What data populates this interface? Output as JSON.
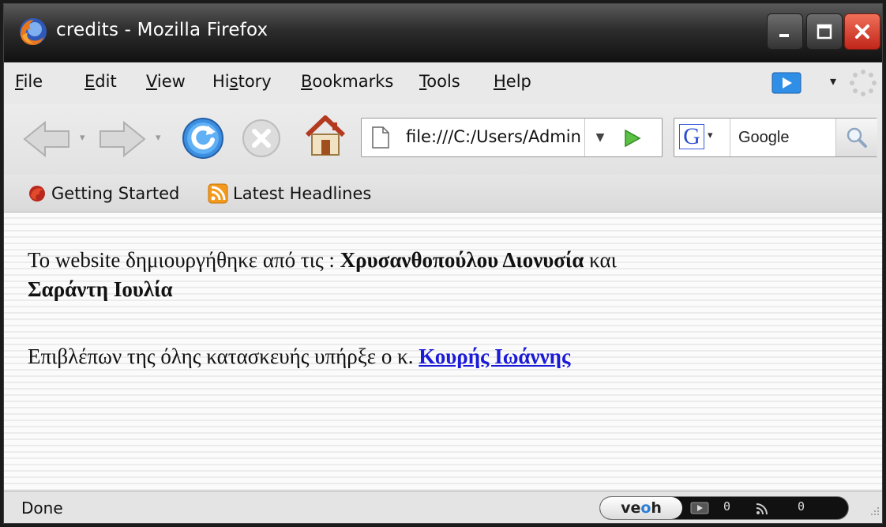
{
  "window": {
    "title": "credits - Mozilla Firefox"
  },
  "menu": {
    "items": [
      {
        "label": "File",
        "underline": "F",
        "rest": "ile"
      },
      {
        "label": "Edit",
        "underline": "E",
        "rest": "dit"
      },
      {
        "label": "View",
        "underline": "V",
        "rest": "iew"
      },
      {
        "label": "History",
        "pre": "Hi",
        "underline": "s",
        "rest": "tory"
      },
      {
        "label": "Bookmarks",
        "underline": "B",
        "rest": "ookmarks"
      },
      {
        "label": "Tools",
        "underline": "T",
        "rest": "ools"
      },
      {
        "label": "Help",
        "underline": "H",
        "rest": "elp"
      }
    ]
  },
  "navigation": {
    "url": "file:///C:/Users/Admin/credits.html",
    "search_placeholder": "Google",
    "search_engine_letter": "G"
  },
  "bookmarks": {
    "getting_started": "Getting Started",
    "latest_headlines": "Latest Headlines"
  },
  "content": {
    "p1_prefix": "Το website δημιουργήθηκε από τις : ",
    "p1_name1": "Χρυσανθοπούλου Διονυσία",
    "p1_and": " και ",
    "p1_name2": "Σαράντη Ιουλία",
    "p2_prefix": "Επιβλέπων της όλης κατασκευής υπήρξε ο κ. ",
    "p2_link": "Κουρής Ιωάννης"
  },
  "status": {
    "text": "Done",
    "veoh_brand_pre": "ve",
    "veoh_brand_o": "o",
    "veoh_brand_post": "h",
    "video_count": "0",
    "feed_count": "0"
  },
  "colors": {
    "link": "#1a1ad8",
    "close_button": "#d93a26",
    "go_arrow": "#3fa12b"
  },
  "icons": {
    "firefox_logo": "firefox-logo-icon",
    "back": "back-arrow-icon",
    "forward": "forward-arrow-icon",
    "reload": "reload-icon",
    "stop": "stop-icon",
    "home": "home-icon",
    "page": "page-icon",
    "go": "go-arrow-icon",
    "search": "magnifier-icon",
    "rss": "rss-feed-icon"
  }
}
